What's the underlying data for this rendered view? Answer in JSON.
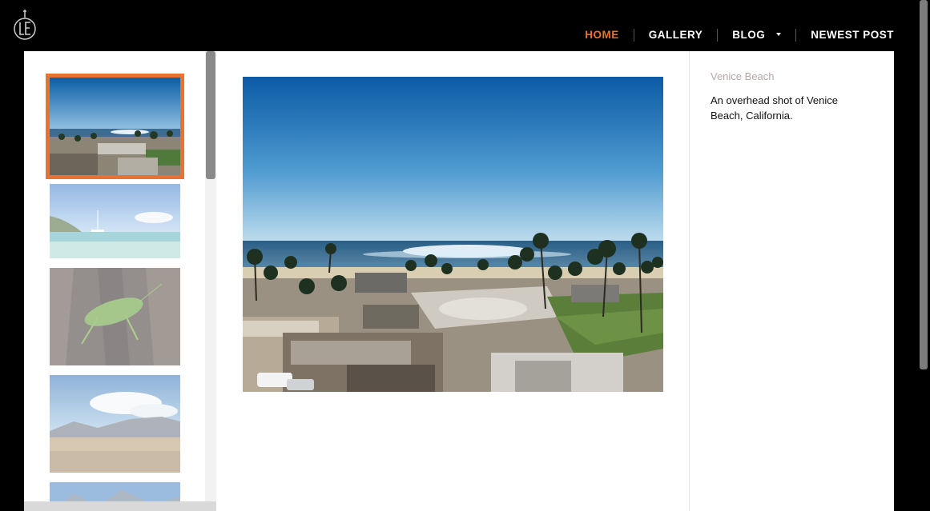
{
  "site": {
    "logo_icon": "le-monogram-logo-icon"
  },
  "nav": {
    "items": [
      {
        "label": "HOME",
        "active": true
      },
      {
        "label": "GALLERY",
        "active": false
      },
      {
        "label": "BLOG",
        "active": false,
        "has_dropdown": true
      },
      {
        "label": "NEWEST POST",
        "active": false
      }
    ]
  },
  "colors": {
    "accent": "#e8722f",
    "caption_title": "#b8a8a8"
  },
  "gallery": {
    "thumbnails": [
      {
        "subject": "venice-beach-overhead",
        "selected": true
      },
      {
        "subject": "tropical-lagoon-sailboat",
        "selected": false
      },
      {
        "subject": "green-katydid-on-bark",
        "selected": false
      },
      {
        "subject": "desert-mountains-clouds",
        "selected": false
      },
      {
        "subject": "partial-mountain-view",
        "selected": false
      }
    ],
    "current": {
      "title": "Venice Beach",
      "description": "An overhead shot of Venice Beach, California."
    }
  }
}
